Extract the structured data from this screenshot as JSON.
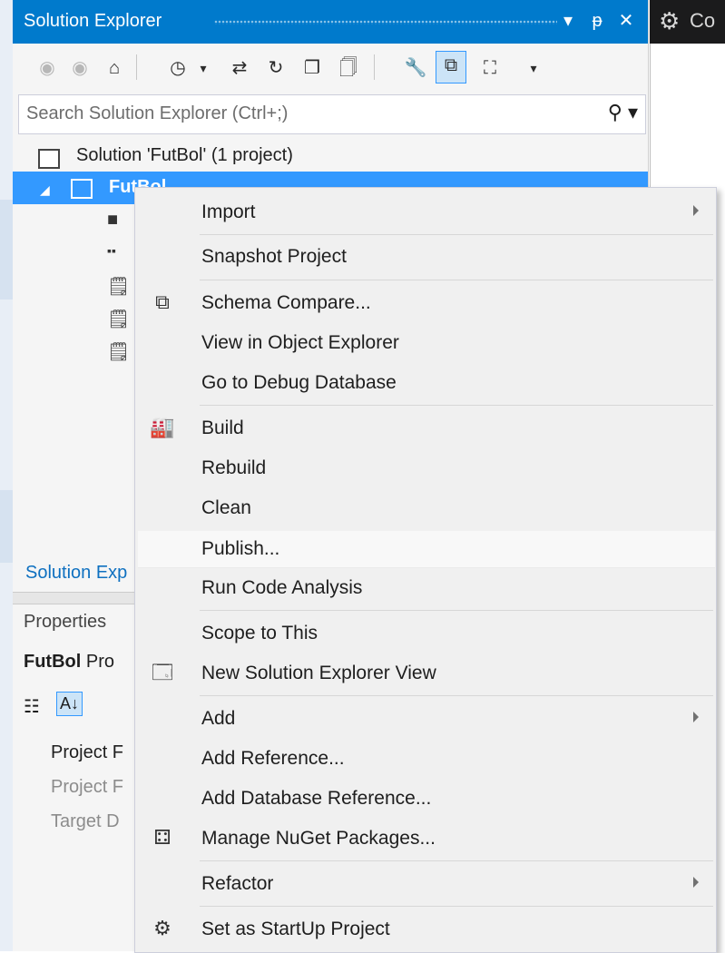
{
  "solution_explorer": {
    "title": "Solution Explorer",
    "title_buttons": [
      "▾",
      "ᵽ",
      "✕"
    ],
    "right_window_fragment": "Co",
    "search_placeholder": "Search Solution Explorer (Ctrl+;)",
    "tree": {
      "solution_label": "Solution 'FutBol' (1 project)",
      "project_label": "FutBol"
    },
    "bottom_tab_label": "Solution Exp"
  },
  "properties": {
    "title": "Properties",
    "object_name": "FutBol",
    "object_type": "Pro",
    "rows": [
      "Project F",
      "Project F",
      "Target D"
    ]
  },
  "context_menu": {
    "items": [
      {
        "label": "Import",
        "submenu": true,
        "icon": null
      },
      {
        "label": "Snapshot Project",
        "submenu": false,
        "icon": null
      },
      {
        "label": "Schema Compare...",
        "submenu": false,
        "icon": "schema-compare-icon"
      },
      {
        "label": "View in Object Explorer",
        "submenu": false,
        "icon": null
      },
      {
        "label": "Go to Debug Database",
        "submenu": false,
        "icon": null
      },
      {
        "label": "Build",
        "submenu": false,
        "icon": "build-icon"
      },
      {
        "label": "Rebuild",
        "submenu": false,
        "icon": null
      },
      {
        "label": "Clean",
        "submenu": false,
        "icon": null
      },
      {
        "label": "Publish...",
        "submenu": false,
        "icon": null,
        "highlighted": true
      },
      {
        "label": "Run Code Analysis",
        "submenu": false,
        "icon": null
      },
      {
        "label": "Scope to This",
        "submenu": false,
        "icon": null
      },
      {
        "label": "New Solution Explorer View",
        "submenu": false,
        "icon": "new-view-icon"
      },
      {
        "label": "Add",
        "submenu": true,
        "icon": null
      },
      {
        "label": "Add Reference...",
        "submenu": false,
        "icon": null
      },
      {
        "label": "Add Database Reference...",
        "submenu": false,
        "icon": null
      },
      {
        "label": "Manage NuGet Packages...",
        "submenu": false,
        "icon": "nuget-icon"
      },
      {
        "label": "Refactor",
        "submenu": true,
        "icon": null
      },
      {
        "label": "Set as StartUp Project",
        "submenu": false,
        "icon": "gear-icon"
      }
    ]
  },
  "colors": {
    "accent": "#007acc",
    "selection": "#3399ff",
    "menu_bg": "#f0f0f0"
  }
}
